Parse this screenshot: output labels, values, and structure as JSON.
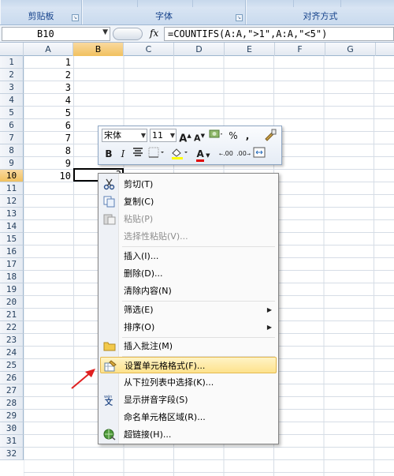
{
  "ribbon": {
    "groups": [
      {
        "title": "剪贴板"
      },
      {
        "title": "字体"
      },
      {
        "title": "对齐方式"
      }
    ]
  },
  "formula_bar": {
    "name_box": "B10",
    "fx": "fx",
    "formula": "=COUNTIFS(A:A,\">1\",A:A,\"<5\")"
  },
  "columns": [
    "A",
    "B",
    "C",
    "D",
    "E",
    "F",
    "G"
  ],
  "selected_column": "B",
  "rows": [
    "1",
    "2",
    "3",
    "4",
    "5",
    "6",
    "7",
    "8",
    "9",
    "10",
    "11",
    "12",
    "13",
    "14",
    "15",
    "16",
    "17",
    "18",
    "19",
    "20",
    "21",
    "22",
    "23",
    "24",
    "25",
    "26",
    "27",
    "28",
    "29",
    "30",
    "31",
    "32"
  ],
  "selected_row": "10",
  "cells_A": [
    "1",
    "2",
    "3",
    "4",
    "5",
    "6",
    "7",
    "8",
    "9",
    "10"
  ],
  "cell_B10": "3",
  "mini_toolbar": {
    "font": "宋体",
    "size": "11",
    "grow_font": "A",
    "shrink_font": "A",
    "percent": "%",
    "comma": ",",
    "bold": "B",
    "italic": "I",
    "font_color": "A",
    "inc_decimal": ".00",
    "dec_decimal": ".00"
  },
  "context_menu": {
    "items": [
      {
        "label": "剪切(T)",
        "disabled": false
      },
      {
        "label": "复制(C)",
        "disabled": false
      },
      {
        "label": "粘贴(P)",
        "disabled": true
      },
      {
        "label": "选择性粘贴(V)...",
        "disabled": true
      },
      {
        "label": "插入(I)...",
        "disabled": false
      },
      {
        "label": "删除(D)...",
        "disabled": false
      },
      {
        "label": "清除内容(N)",
        "disabled": false
      },
      {
        "label": "筛选(E)",
        "disabled": false
      },
      {
        "label": "排序(O)",
        "disabled": false
      },
      {
        "label": "插入批注(M)",
        "disabled": false
      },
      {
        "label": "设置单元格格式(F)...",
        "disabled": false,
        "highlighted": true
      },
      {
        "label": "从下拉列表中选择(K)...",
        "disabled": false
      },
      {
        "label": "显示拼音字段(S)",
        "disabled": false
      },
      {
        "label": "命名单元格区域(R)...",
        "disabled": false
      },
      {
        "label": "超链接(H)...",
        "disabled": false
      }
    ]
  },
  "colors": {
    "highlight": "#fde28c",
    "selection_header": "#f1c15f",
    "annotation_arrow": "#e02020"
  }
}
